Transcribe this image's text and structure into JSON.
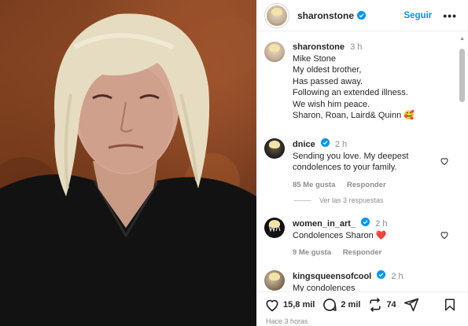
{
  "post": {
    "username": "sharonstone",
    "follow_label": "Seguir",
    "more_label": "•••",
    "caption_time": "3 h",
    "caption_lines": [
      "Mike Stone",
      "My oldest brother,",
      "Has passed away.",
      "Following an extended illness.",
      "We wish him peace.",
      "Sharon, Roan, Laird& Quinn 🥰"
    ]
  },
  "comments": [
    {
      "username": "dnice",
      "time": "2 h",
      "text_lines": [
        "Sending you love. My deepest",
        "condolences to your family."
      ],
      "likes": "85 Me gusta",
      "reply_label": "Responder"
    },
    {
      "username": "women_in_art_",
      "time": "2 h",
      "text_lines": [
        "Condolences Sharon ❤️"
      ],
      "likes": "9 Me gusta",
      "reply_label": "Responder"
    },
    {
      "username": "kingsqueensofcool",
      "time": "2 h",
      "text_lines": [
        "My condolences"
      ],
      "likes": "",
      "reply_label": ""
    }
  ],
  "view_replies_label": "Ver las 3 respuestas",
  "actions": {
    "likes": "15,8 mil",
    "comments": "2 mil",
    "reposts": "74"
  },
  "timestamp": "Hace 3 horas",
  "colors": {
    "accent_blue": "#0095f6",
    "heart_red": "#ed4956",
    "verified_blue": "#0095f6"
  }
}
